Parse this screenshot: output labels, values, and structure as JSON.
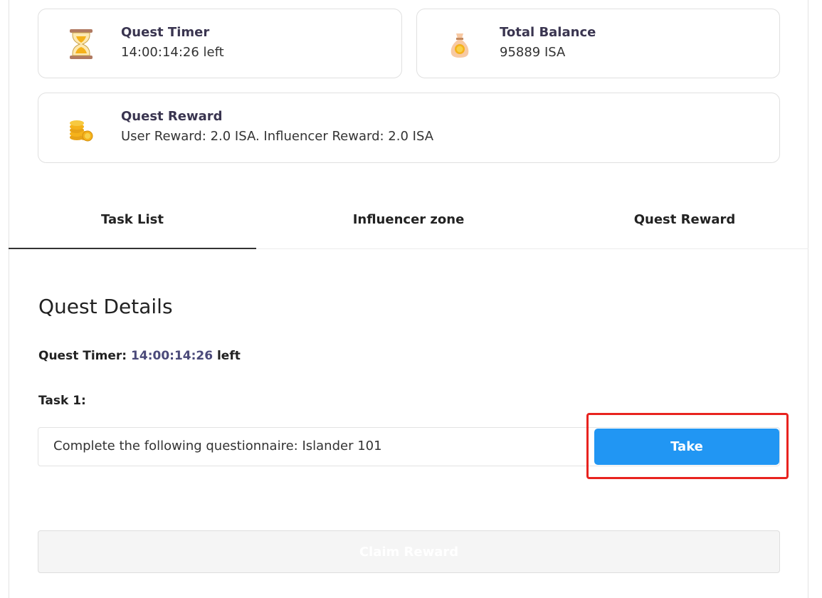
{
  "cards": {
    "quest_timer": {
      "title": "Quest Timer",
      "value": "14:00:14:26 left",
      "icon": "hourglass-icon"
    },
    "total_balance": {
      "title": "Total Balance",
      "value": "95889 ISA",
      "icon": "money-bag-icon"
    },
    "quest_reward": {
      "title": "Quest Reward",
      "value": "User Reward: 2.0 ISA. Influencer Reward: 2.0 ISA",
      "icon": "coins-stack-icon"
    }
  },
  "tabs": [
    {
      "label": "Task List",
      "active": true
    },
    {
      "label": "Influencer zone",
      "active": false
    },
    {
      "label": "Quest Reward",
      "active": false
    }
  ],
  "details": {
    "title": "Quest Details",
    "timer_label": "Quest Timer:",
    "timer_value": "14:00:14:26",
    "timer_suffix": "left",
    "task_label": "Task 1:",
    "task_text": "Complete the following questionnaire: Islander 101",
    "take_label": "Take",
    "claim_label": "Claim Reward"
  },
  "colors": {
    "primary": "#2196f3",
    "highlight": "#e8231f",
    "timer_accent": "#4b4a7a"
  }
}
